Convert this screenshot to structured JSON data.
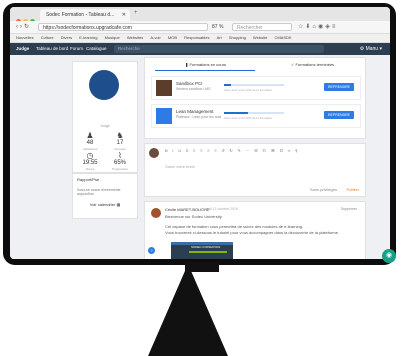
{
  "browser": {
    "tab_title": "Sodec Formation - Tableau d...",
    "url": "https://sodecformations.upgradcafe.com",
    "zoom": "87 %",
    "search_placeholder": "Rechercher",
    "bookmarks": [
      "Nouvelles",
      "Culture",
      "Divers",
      "E-learning",
      "Musique",
      "Websites",
      "A-voir",
      "MOB",
      "Responsables",
      "Art",
      "Shopping",
      "Website",
      "CMASDK"
    ]
  },
  "app": {
    "brand": "Judge",
    "nav": [
      "Tableau de bord",
      "Forum",
      "Catalogue"
    ],
    "search_placeholder": "Recherche",
    "user_menu": "Manu"
  },
  "profile": {
    "username": "Judge",
    "stats": [
      {
        "icon": "person-icon",
        "value": "48",
        "label": "Utilisateurs"
      },
      {
        "icon": "people-icon",
        "value": "17",
        "label": "Groupes"
      },
      {
        "icon": "clock-icon",
        "value": "19:55",
        "label": "Temps"
      },
      {
        "icon": "chart-icon",
        "value": "65%",
        "label": "Progression"
      }
    ]
  },
  "links_panel": {
    "title": "Rapport/Pse",
    "subtitle": "Sous-se aucun evenemente aujourd'hui",
    "calendar_label": "Voir calendrier"
  },
  "formations": {
    "tab_active": "Formations en cours",
    "tab_other": "Formations terminées",
    "courses": [
      {
        "title": "Sandbox PCI",
        "subtitle": "Secteur sandbox LMS",
        "progress": 0.12,
        "progress_label": "Vous avez suivi 12% de la formation",
        "button": "REPRENDRE"
      },
      {
        "title": "Lean Management",
        "subtitle": "Plateaux : Lean pour les nuls",
        "progress": 0.4,
        "progress_label": "Vous avez suivi 40% de la formation",
        "button": "REPRENDRE"
      }
    ]
  },
  "editor": {
    "toolbar": "B I U S ≡ ≡ ≡ ≡ ↺ ↻ ✎ ⋯ ☰ ☷ ⌘ ⊡ ∞ ¶",
    "placeholder": "Saisir votre texte",
    "publish_label": "Sans privilèges",
    "submit_label": "Publier"
  },
  "post": {
    "author": "Cécile MARET-BOUCHE",
    "date": "Lundi 12 octobre 2015",
    "delete_label": "Supprimer",
    "lines": [
      "Bienvenue sur Sodec University.",
      "Cet espace de formation vous permettra de suivre des modules de e-learning.",
      "Vous trouverez ci-dessous le tutoriel pour vous accompagner dans la découverte de la plateforme."
    ],
    "image_caption": "SODEC FORMATION"
  },
  "colors": {
    "nav_bg": "#2c3e50",
    "accent": "#2d7be5",
    "chat": "#16a085"
  }
}
